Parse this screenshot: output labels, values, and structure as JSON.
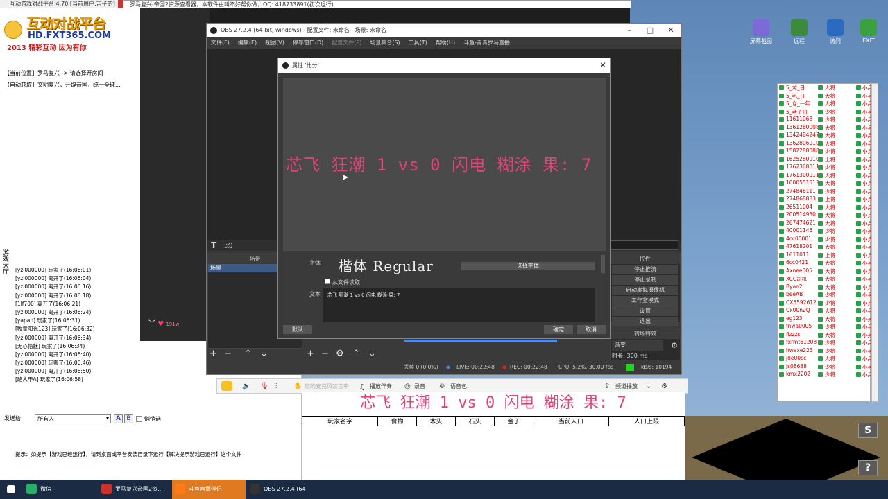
{
  "chat": {
    "title": "互动游戏对战平台 4.70 [当前用户:吉子的]",
    "banner_main": "互动对战平台",
    "banner_url": "HD.FXT365.COM",
    "banner_slogan": "2013 精彩互动 因为有你",
    "line1": "【当前位置】罗马复兴 -> 请选择开房间",
    "line2": "【自动获取】文明复兴，开辟帝国，统一全球...",
    "side_label": "游戏大厅",
    "log": [
      "[yzl000000] 玩家了(16:06:01)",
      "[yzl000000] 离开了(16:06:04)",
      "[yzl000000] 离开了(16:06:16)",
      "[yzl000000] 离开了(16:06:18)",
      "[1lf700] 离开了(16:06:21)",
      "[yzl000000] 离开了(16:06:24)",
      "[yapan] 玩家了(16:06:31)",
      "[牧童阳光123] 玩家了(16:06:32)",
      "[yzl000000] 离开了(16:06:34)",
      "[无心悟魅] 玩家了(16:06:34)",
      "[yzl000000] 离开了(16:06:40)",
      "[yzl000000] 玩家了(16:06:46)",
      "[yzl000000] 离开了(16:06:50)",
      "[路人甲A] 玩家了(16:06:58)"
    ],
    "send_label": "发送给:",
    "send_target": "所有人",
    "fmt_a": "A",
    "fmt_b": "B",
    "private_label": "悄悄话",
    "hint": "提示：如提示【游戏已经运行】，请到桌面或平台安装目录下运行【解决提示游戏已运行】这个文件"
  },
  "browser": {
    "title": "罗马复兴-帝国2资源查看器，本软件由叫不好帮你做，QQ: 418733891(初次运行)"
  },
  "obs": {
    "title": "OBS 27.2.4 (64-bit, windows) - 配置文件: 未命名 - 场景: 未命名",
    "menu": [
      "文件(F)",
      "编辑(E)",
      "视图(V)",
      "停靠窗口(D)",
      "配置文件(P)",
      "场景集合(S)",
      "工具(T)",
      "帮助(H)",
      "斗鱼-青青罗马直播"
    ],
    "source_name": "比分",
    "scenes_header": "场景",
    "scene_item": "场景",
    "controls_header": "控件",
    "controls": [
      "停止推流",
      "停止录制",
      "启动虚拟摄像机",
      "工作室模式",
      "设置",
      "退出"
    ],
    "transition_header": "转场特效",
    "transition_value": "渐变",
    "duration_label": "时长",
    "duration_value": "300 ms",
    "status": {
      "dropped": "丢帧 0 (0.0%)",
      "live": "LIVE: 00:22:48",
      "rec": "REC: 00:22:48",
      "cpu": "CPU: 5.2%, 30.00 fps",
      "kbps": "kb/s: 10194"
    }
  },
  "dialog": {
    "title": "属性 '比分'",
    "preview_text": "芯飞 狂潮 1 vs 0 闪电 糊涂 果: 7",
    "font_label": "字体",
    "font_value": "楷体 Regular",
    "select_font": "选择字体",
    "from_file": "从文件读取",
    "text_label": "文本",
    "text_value": "芯飞 狂潮 1 vs 0 闪电 糊涂 果: 7",
    "default_btn": "默认",
    "ok_btn": "确定",
    "cancel_btn": "取消"
  },
  "desktop": {
    "icons": [
      {
        "label": "屏幕截图",
        "color": "#7c6ad8"
      },
      {
        "label": "远程",
        "color": "#3c8a3c"
      },
      {
        "label": "访问",
        "color": "#2a6ac0"
      },
      {
        "label": "EXIT",
        "color": "#3aa040"
      }
    ]
  },
  "players": [
    [
      "5_龙_日",
      "大将",
      "小兵"
    ],
    [
      "5_毛_日",
      "大将",
      "小兵"
    ],
    [
      "5_仓_一年",
      "大将",
      "小兵"
    ],
    [
      "5_老子日",
      "少将",
      "小兵"
    ],
    [
      "11611068",
      "少将",
      "小兵"
    ],
    [
      "1361260008",
      "大将",
      "小兵"
    ],
    [
      "1342484247",
      "大将",
      "小兵"
    ],
    [
      "1362806010",
      "大将",
      "小兵"
    ],
    [
      "1582288088",
      "少将",
      "小兵"
    ],
    [
      "1625280010",
      "上将",
      "小兵"
    ],
    [
      "1762368011",
      "少将",
      "小兵"
    ],
    [
      "1761300011",
      "大将",
      "小兵"
    ],
    [
      "1000551512",
      "大将",
      "小兵"
    ],
    [
      "274846111",
      "少将",
      "小兵"
    ],
    [
      "274868883",
      "上将",
      "小兵"
    ],
    [
      "26511004",
      "大将",
      "小兵"
    ],
    [
      "200514950",
      "大将",
      "小兵"
    ],
    [
      "267474621",
      "大将",
      "小兵"
    ],
    [
      "40001146",
      "少将",
      "小兵"
    ],
    [
      "4cc00001",
      "少将",
      "小兵"
    ],
    [
      "47618201",
      "大将",
      "小兵"
    ],
    [
      "1611011",
      "上将",
      "小兵"
    ],
    [
      "6cc0421",
      "大将",
      "小兵"
    ],
    [
      "Axnee005",
      "大将",
      "小兵"
    ],
    [
      "XCC司机",
      "大将",
      "小兵"
    ],
    [
      "Byan2",
      "大将",
      "小兵"
    ],
    [
      "beeAB",
      "少将",
      "小兵"
    ],
    [
      "CX5592612",
      "少将",
      "小兵"
    ],
    [
      "Cx00n2Q",
      "大将",
      "小兵"
    ],
    [
      "eg123",
      "大将",
      "小兵"
    ],
    [
      "fnwa0005",
      "少将",
      "小兵"
    ],
    [
      "fizzzs",
      "大将",
      "小兵"
    ],
    [
      "fxrmt61208",
      "少将",
      "小兵"
    ],
    [
      "hwaxe223",
      "少将",
      "小兵"
    ],
    [
      "j8e00cc",
      "大将",
      "小兵"
    ],
    [
      "js08688",
      "少将",
      "小兵"
    ],
    [
      "kmx2202",
      "少将",
      "小兵"
    ]
  ],
  "subbar": {
    "mic_hint": "您的麦克风禁言中",
    "song": "播放伴奏",
    "record": "录音",
    "voice": "语音包",
    "danmaku": "频道播放"
  },
  "overlay_text": "芯飞 狂潮 1 vs 0 闪电 糊涂 果: 7",
  "game_table": {
    "headers": [
      "玩家名字",
      "食物",
      "木头",
      "石头",
      "金子",
      "当前人口",
      "人口上限"
    ]
  },
  "game_buttons": {
    "top": "S",
    "bottom": "?"
  },
  "video_live_count": "191w",
  "taskbar": [
    {
      "label": "微信",
      "color": "#2aae67"
    },
    {
      "label": "罗马复兴帝国2资...",
      "color": "#c8332b"
    },
    {
      "label": "斗鱼直播伴侣",
      "color": "#ff7a18"
    },
    {
      "label": "OBS 27.2.4 (64",
      "color": "#333333"
    }
  ]
}
